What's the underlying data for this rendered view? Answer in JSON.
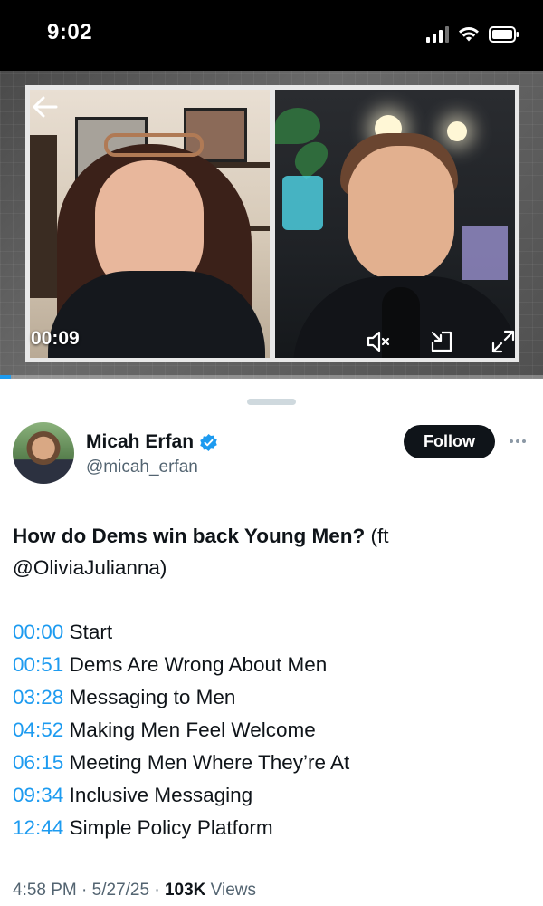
{
  "status_bar": {
    "time": "9:02"
  },
  "video": {
    "timecode": "00:09",
    "progress_fraction": 0.02,
    "controls": {
      "back": "back-arrow-icon",
      "mute": "muted-speaker-icon",
      "pip": "picture-in-picture-icon",
      "fullscreen": "expand-icon"
    }
  },
  "author": {
    "name": "Micah Erfan",
    "handle": "@micah_erfan",
    "verified": true,
    "follow_label": "Follow"
  },
  "post": {
    "title": "How do Dems win back Young Men?",
    "title_suffix": " (ft @OliviaJulianna)",
    "chapters": [
      {
        "time": "00:00",
        "label": " Start"
      },
      {
        "time": "00:51",
        "label": " Dems Are Wrong About Men"
      },
      {
        "time": "03:28",
        "label": " Messaging to Men"
      },
      {
        "time": "04:52",
        "label": " Making Men Feel Welcome"
      },
      {
        "time": "06:15",
        "label": " Meeting Men Where They’re At"
      },
      {
        "time": "09:34",
        "label": " Inclusive Messaging"
      },
      {
        "time": "12:44",
        "label": " Simple Policy Platform"
      }
    ]
  },
  "meta": {
    "time": "4:58 PM",
    "date": "5/27/25",
    "views_count": "103K",
    "views_label": "Views",
    "separator": " · "
  },
  "colors": {
    "accent": "#1d9bf0",
    "text": "#0f1419",
    "secondary": "#536471"
  }
}
